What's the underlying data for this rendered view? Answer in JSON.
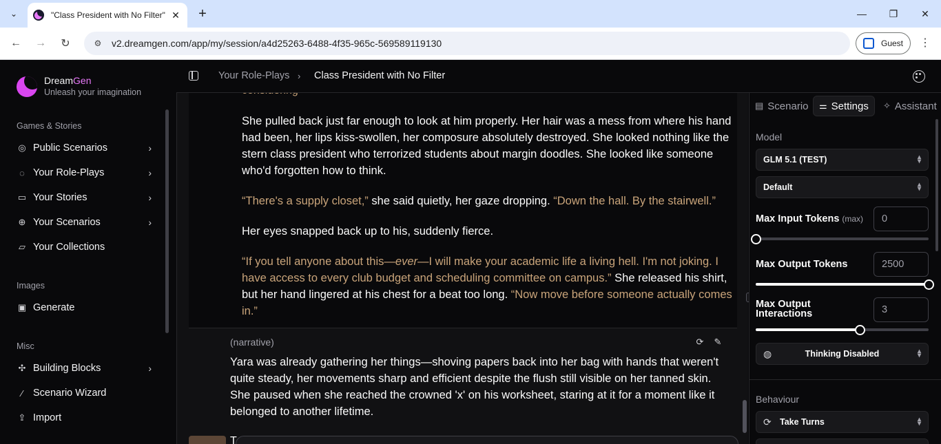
{
  "browser": {
    "tab_title": "\"Class President with No Filter\"",
    "url": "v2.dreamgen.com/app/my/session/a4d25263-6488-4f35-965c-569589119130",
    "profile_label": "Guest"
  },
  "brand": {
    "name_part1": "Dream",
    "name_part2": "Gen",
    "tagline": "Unleash your imagination",
    "accent_color": "#e879f9"
  },
  "sidebar": {
    "section_games": "Games & Stories",
    "section_images": "Images",
    "section_misc": "Misc",
    "items": [
      {
        "label": "Public Scenarios",
        "icon": "compass-icon",
        "has_chevron": true
      },
      {
        "label": "Your Role-Plays",
        "icon": "chat-bubble-icon",
        "has_chevron": true
      },
      {
        "label": "Your Stories",
        "icon": "book-icon",
        "has_chevron": true
      },
      {
        "label": "Your Scenarios",
        "icon": "globe-icon",
        "has_chevron": true
      },
      {
        "label": "Your Collections",
        "icon": "folder-icon",
        "has_chevron": false
      },
      {
        "label": "Generate",
        "icon": "image-plus-icon",
        "has_chevron": false
      },
      {
        "label": "Building Blocks",
        "icon": "puzzle-icon",
        "has_chevron": true
      },
      {
        "label": "Scenario Wizard",
        "icon": "magic-wand-icon",
        "has_chevron": false
      },
      {
        "label": "Import",
        "icon": "upload-icon",
        "has_chevron": false
      }
    ]
  },
  "breadcrumb": {
    "parent": "Your Role-Plays",
    "current": "Class President with No Filter"
  },
  "chat": {
    "cut_top_text": "considering",
    "p1": "She pulled back just far enough to look at him properly. Her hair was a mess from where his hand had been, her lips kiss-swollen, her composure absolutely destroyed. She looked nothing like the stern class president who terrorized students about margin doodles. She looked like someone who'd forgotten how to think.",
    "p2_q1": "“There's a supply closet,”",
    "p2_mid": " she said quietly, her gaze dropping. ",
    "p2_q2": "“Down the hall. By the stairwell.”",
    "p3": "Her eyes snapped back up to his, suddenly fierce.",
    "p4_q1a": "“If you tell anyone about this—",
    "p4_q1_em": "ever",
    "p4_q1b": "—I will make your academic life a living hell. I'm not joking. I have access to every club budget and scheduling committee on campus.”",
    "p4_mid": " She released his shirt, but her hand lingered at his chest for a beat too long. ",
    "p4_q2": "“Now move before someone actually comes in.”",
    "narrative_label": "(narrative)",
    "p5": "Yara was already gathering her things—shoving papers back into her bag with hands that weren't quite steady, her movements sharp and efficient despite the flush still visible on her tanned skin. She paused when she reached the crowned 'x' on his worksheet, staring at it for a moment like it belonged to another lifetime.",
    "next_text": "T",
    "dialogue_color": "#c9a47a"
  },
  "right_panel": {
    "tabs": [
      {
        "label": "Scenario",
        "icon": "document-icon",
        "active": false
      },
      {
        "label": "Settings",
        "icon": "sliders-icon",
        "active": true
      },
      {
        "label": "Assistant",
        "icon": "sparkle-icon",
        "active": false
      }
    ],
    "model_label": "Model",
    "model_value": "GLM 5.1 (TEST)",
    "preset_value": "Default",
    "max_input_label": "Max Input Tokens",
    "max_input_suffix": "(max)",
    "max_input_value": "0",
    "max_input_fraction": 0.0,
    "max_output_label": "Max Output Tokens",
    "max_output_value": "2500",
    "max_output_fraction": 1.0,
    "max_interactions_label": "Max Output Interactions",
    "max_interactions_value": "3",
    "max_interactions_fraction": 0.6,
    "thinking_value": "Thinking Disabled",
    "behaviour_label": "Behaviour",
    "behaviour_value": "Take Turns"
  }
}
